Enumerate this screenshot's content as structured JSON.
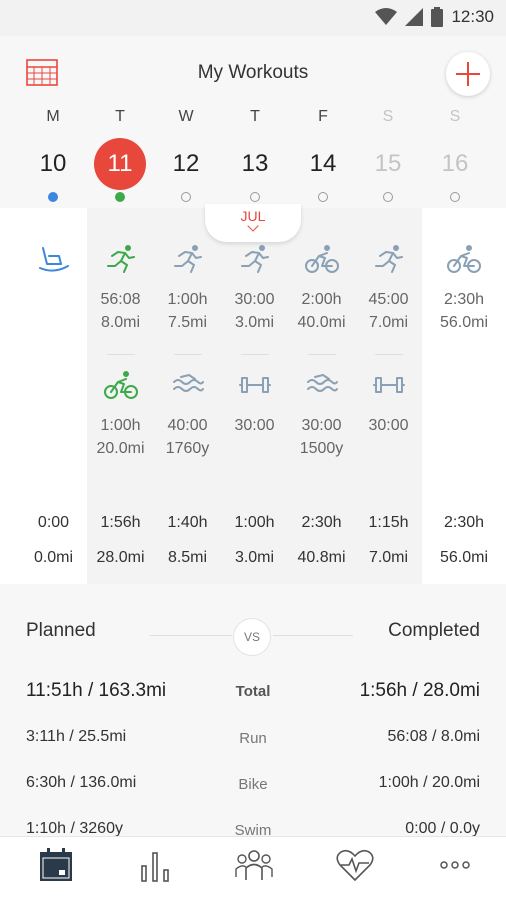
{
  "status": {
    "time": "12:30"
  },
  "header": {
    "title": "My Workouts",
    "month": "JUL"
  },
  "days": [
    {
      "dow": "M",
      "num": "10",
      "state": "past",
      "dot": "blue"
    },
    {
      "dow": "T",
      "num": "11",
      "state": "today",
      "dot": "green"
    },
    {
      "dow": "W",
      "num": "12",
      "state": "normal",
      "dot": "empty"
    },
    {
      "dow": "T",
      "num": "13",
      "state": "normal",
      "dot": "empty"
    },
    {
      "dow": "F",
      "num": "14",
      "state": "normal",
      "dot": "empty"
    },
    {
      "dow": "S",
      "num": "15",
      "state": "future",
      "dot": "empty"
    },
    {
      "dow": "S",
      "num": "16",
      "state": "future",
      "dot": "empty"
    }
  ],
  "week": [
    {
      "workouts": [
        {
          "icon": "rest-icon",
          "color": "blue"
        }
      ],
      "total_time": "0:00",
      "total_dist": "0.0mi"
    },
    {
      "workouts": [
        {
          "icon": "run-icon",
          "color": "green",
          "time": "56:08",
          "dist": "8.0mi"
        },
        {
          "icon": "bike-icon",
          "color": "green",
          "time": "1:00h",
          "dist": "20.0mi"
        }
      ],
      "total_time": "1:56h",
      "total_dist": "28.0mi"
    },
    {
      "workouts": [
        {
          "icon": "run-icon",
          "color": "gray",
          "time": "1:00h",
          "dist": "7.5mi"
        },
        {
          "icon": "swim-icon",
          "color": "gray",
          "time": "40:00",
          "dist": "1760y"
        }
      ],
      "total_time": "1:40h",
      "total_dist": "8.5mi"
    },
    {
      "workouts": [
        {
          "icon": "run-icon",
          "color": "gray",
          "time": "30:00",
          "dist": "3.0mi"
        },
        {
          "icon": "strength-icon",
          "color": "gray",
          "time": "30:00",
          "dist": ""
        }
      ],
      "total_time": "1:00h",
      "total_dist": "3.0mi"
    },
    {
      "workouts": [
        {
          "icon": "bike-icon",
          "color": "gray",
          "time": "2:00h",
          "dist": "40.0mi"
        },
        {
          "icon": "swim-icon",
          "color": "gray",
          "time": "30:00",
          "dist": "1500y"
        }
      ],
      "total_time": "2:30h",
      "total_dist": "40.8mi"
    },
    {
      "workouts": [
        {
          "icon": "run-icon",
          "color": "gray",
          "time": "45:00",
          "dist": "7.0mi"
        },
        {
          "icon": "strength-icon",
          "color": "gray",
          "time": "30:00",
          "dist": ""
        }
      ],
      "total_time": "1:15h",
      "total_dist": "7.0mi"
    },
    {
      "workouts": [
        {
          "icon": "bike-icon",
          "color": "gray",
          "time": "2:30h",
          "dist": "56.0mi"
        }
      ],
      "total_time": "2:30h",
      "total_dist": "56.0mi"
    }
  ],
  "summary": {
    "planned_label": "Planned",
    "completed_label": "Completed",
    "vs_label": "VS",
    "rows": [
      {
        "label": "Total",
        "planned": "11:51h / 163.3mi",
        "completed": "1:56h / 28.0mi"
      },
      {
        "label": "Run",
        "planned": "3:11h / 25.5mi",
        "completed": "56:08 / 8.0mi"
      },
      {
        "label": "Bike",
        "planned": "6:30h / 136.0mi",
        "completed": "1:00h / 20.0mi"
      },
      {
        "label": "Swim",
        "planned": "1:10h / 3260y",
        "completed": "0:00 / 0.0y"
      }
    ]
  },
  "nav": [
    {
      "icon": "calendar-icon"
    },
    {
      "icon": "stats-icon"
    },
    {
      "icon": "team-icon"
    },
    {
      "icon": "heart-rate-icon"
    },
    {
      "icon": "more-icon"
    }
  ],
  "colors": {
    "accent": "#e8473c",
    "green": "#3daa4a",
    "blue": "#3d86e0",
    "gray": "#8aa0b4"
  }
}
